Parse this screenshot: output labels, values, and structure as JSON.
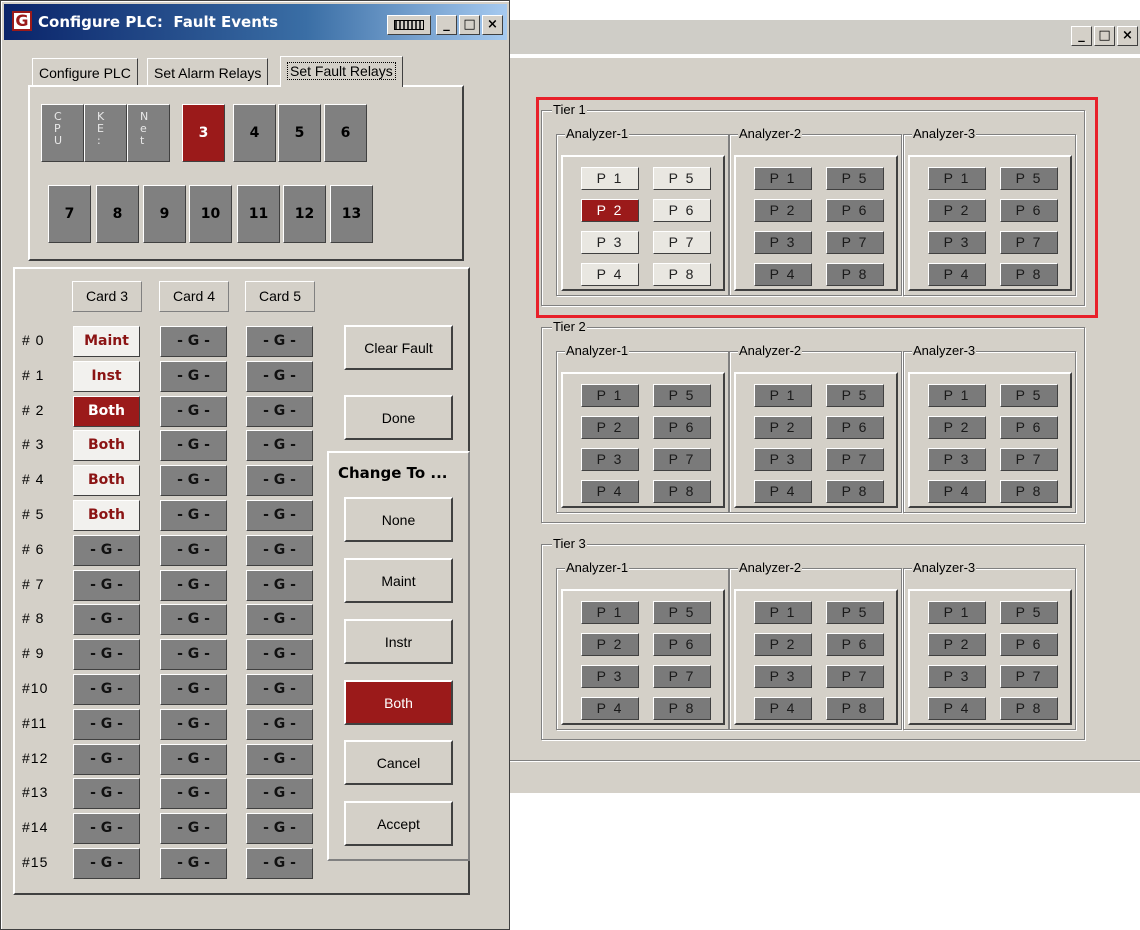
{
  "left_window": {
    "title": "Configure PLC:  Fault Events",
    "controls": {
      "minimize": "_",
      "maximize": "□",
      "close": "×"
    },
    "tabs": [
      "Configure PLC",
      "Set Alarm Relays",
      "Set Fault Relays"
    ],
    "active_tab": "Set Fault Relays",
    "special_cards": [
      "C\nP\nU",
      "K\nE\n:",
      "N\ne\nt"
    ],
    "card_buttons_row1": [
      "3",
      "4",
      "5",
      "6"
    ],
    "card_buttons_row2": [
      "7",
      "8",
      "9",
      "10",
      "11",
      "12",
      "13"
    ],
    "selected_card": "3",
    "card_headers": [
      "Card 3",
      "Card 4",
      "Card 5"
    ],
    "row_labels": [
      "# 0",
      "# 1",
      "# 2",
      "# 3",
      "# 4",
      "# 5",
      "# 6",
      "# 7",
      "# 8",
      "# 9",
      "#10",
      "#11",
      "#12",
      "#13",
      "#14",
      "#15"
    ],
    "card3_values": [
      "Maint",
      "Inst",
      "Both",
      "Both",
      "Both",
      "Both",
      "- G -",
      "- G -",
      "- G -",
      "- G -",
      "- G -",
      "- G -",
      "- G -",
      "- G -",
      "- G -",
      "- G -"
    ],
    "card4_values": [
      "- G -",
      "- G -",
      "- G -",
      "- G -",
      "- G -",
      "- G -",
      "- G -",
      "- G -",
      "- G -",
      "- G -",
      "- G -",
      "- G -",
      "- G -",
      "- G -",
      "- G -",
      "- G -"
    ],
    "card5_values": [
      "- G -",
      "- G -",
      "- G -",
      "- G -",
      "- G -",
      "- G -",
      "- G -",
      "- G -",
      "- G -",
      "- G -",
      "- G -",
      "- G -",
      "- G -",
      "- G -",
      "- G -",
      "- G -"
    ],
    "clear_fault_label": "Clear Fault",
    "done_label": "Done",
    "change_to_title": "Change To ...",
    "change_options": [
      "None",
      "Maint",
      "Instr",
      "Both"
    ],
    "selected_change": "Both",
    "cancel_label": "Cancel",
    "accept_label": "Accept"
  },
  "right_window": {
    "controls": {
      "minimize": "_",
      "maximize": "□",
      "close": "×"
    },
    "tiers": [
      {
        "label": "Tier 1",
        "highlighted": true,
        "analyzers": [
          {
            "label": "Analyzer-1",
            "points": [
              "P 1",
              "P 5",
              "P 2",
              "P 6",
              "P 3",
              "P 7",
              "P 4",
              "P 8"
            ],
            "states": [
              "on",
              "on",
              "red",
              "on",
              "on",
              "on",
              "on",
              "on"
            ]
          },
          {
            "label": "Analyzer-2",
            "points": [
              "P 1",
              "P 5",
              "P 2",
              "P 6",
              "P 3",
              "P 7",
              "P 4",
              "P 8"
            ],
            "states": [
              "off",
              "off",
              "off",
              "off",
              "off",
              "off",
              "off",
              "off"
            ]
          },
          {
            "label": "Analyzer-3",
            "points": [
              "P 1",
              "P 5",
              "P 2",
              "P 6",
              "P 3",
              "P 7",
              "P 4",
              "P 8"
            ],
            "states": [
              "off",
              "off",
              "off",
              "off",
              "off",
              "off",
              "off",
              "off"
            ]
          }
        ]
      },
      {
        "label": "Tier 2",
        "highlighted": false,
        "analyzers": [
          {
            "label": "Analyzer-1",
            "points": [
              "P 1",
              "P 5",
              "P 2",
              "P 6",
              "P 3",
              "P 7",
              "P 4",
              "P 8"
            ],
            "states": [
              "off",
              "off",
              "off",
              "off",
              "off",
              "off",
              "off",
              "off"
            ]
          },
          {
            "label": "Analyzer-2",
            "points": [
              "P 1",
              "P 5",
              "P 2",
              "P 6",
              "P 3",
              "P 7",
              "P 4",
              "P 8"
            ],
            "states": [
              "off",
              "off",
              "off",
              "off",
              "off",
              "off",
              "off",
              "off"
            ]
          },
          {
            "label": "Analyzer-3",
            "points": [
              "P 1",
              "P 5",
              "P 2",
              "P 6",
              "P 3",
              "P 7",
              "P 4",
              "P 8"
            ],
            "states": [
              "off",
              "off",
              "off",
              "off",
              "off",
              "off",
              "off",
              "off"
            ]
          }
        ]
      },
      {
        "label": "Tier 3",
        "highlighted": false,
        "analyzers": [
          {
            "label": "Analyzer-1",
            "points": [
              "P 1",
              "P 5",
              "P 2",
              "P 6",
              "P 3",
              "P 7",
              "P 4",
              "P 8"
            ],
            "states": [
              "off",
              "off",
              "off",
              "off",
              "off",
              "off",
              "off",
              "off"
            ]
          },
          {
            "label": "Analyzer-2",
            "points": [
              "P 1",
              "P 5",
              "P 2",
              "P 6",
              "P 3",
              "P 7",
              "P 4",
              "P 8"
            ],
            "states": [
              "off",
              "off",
              "off",
              "off",
              "off",
              "off",
              "off",
              "off"
            ]
          },
          {
            "label": "Analyzer-3",
            "points": [
              "P 1",
              "P 5",
              "P 2",
              "P 6",
              "P 3",
              "P 7",
              "P 4",
              "P 8"
            ],
            "states": [
              "off",
              "off",
              "off",
              "off",
              "off",
              "off",
              "off",
              "off"
            ]
          }
        ]
      }
    ]
  },
  "colors": {
    "fault_red": "#9b1a1a",
    "highlight_red": "#e8202a",
    "inactive_gray": "#808080",
    "face": "#d4d0c8"
  }
}
